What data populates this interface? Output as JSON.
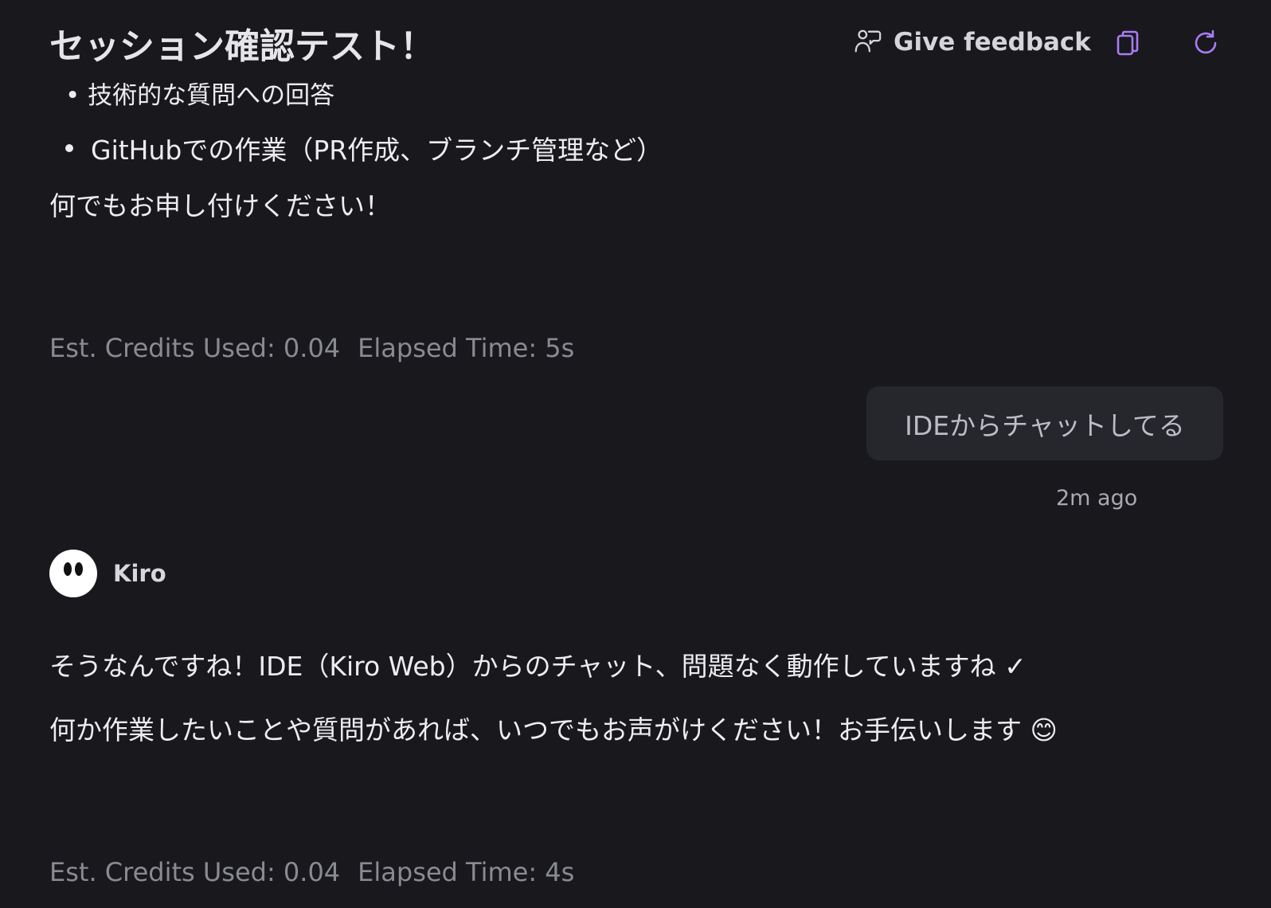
{
  "header": {
    "title": "セッション確認テスト！",
    "feedback_label": "Give feedback"
  },
  "messages": {
    "previous": {
      "cut_line": "• 技術的な質問への回答",
      "bullet": "GitHubでの作業（PR作成、ブランチ管理など）",
      "closing": "何でもお申し付けください！",
      "credits": "Est. Credits Used: 0.04",
      "elapsed": "Elapsed Time: 5s"
    },
    "user": {
      "text": "IDEからチャットしてる",
      "time": "2m ago"
    },
    "agent": {
      "name": "Kiro",
      "line1": "そうなんですね！IDE（Kiro Web）からのチャット、問題なく動作していますね ✓",
      "line2": "何か作業したいことや質問があれば、いつでもお声がけください！お手伝いします 😊",
      "credits": "Est. Credits Used: 0.04",
      "elapsed": "Elapsed Time: 4s"
    }
  },
  "colors": {
    "background": "#18181d",
    "accent": "#a97cf6",
    "bubble": "#26262d"
  }
}
